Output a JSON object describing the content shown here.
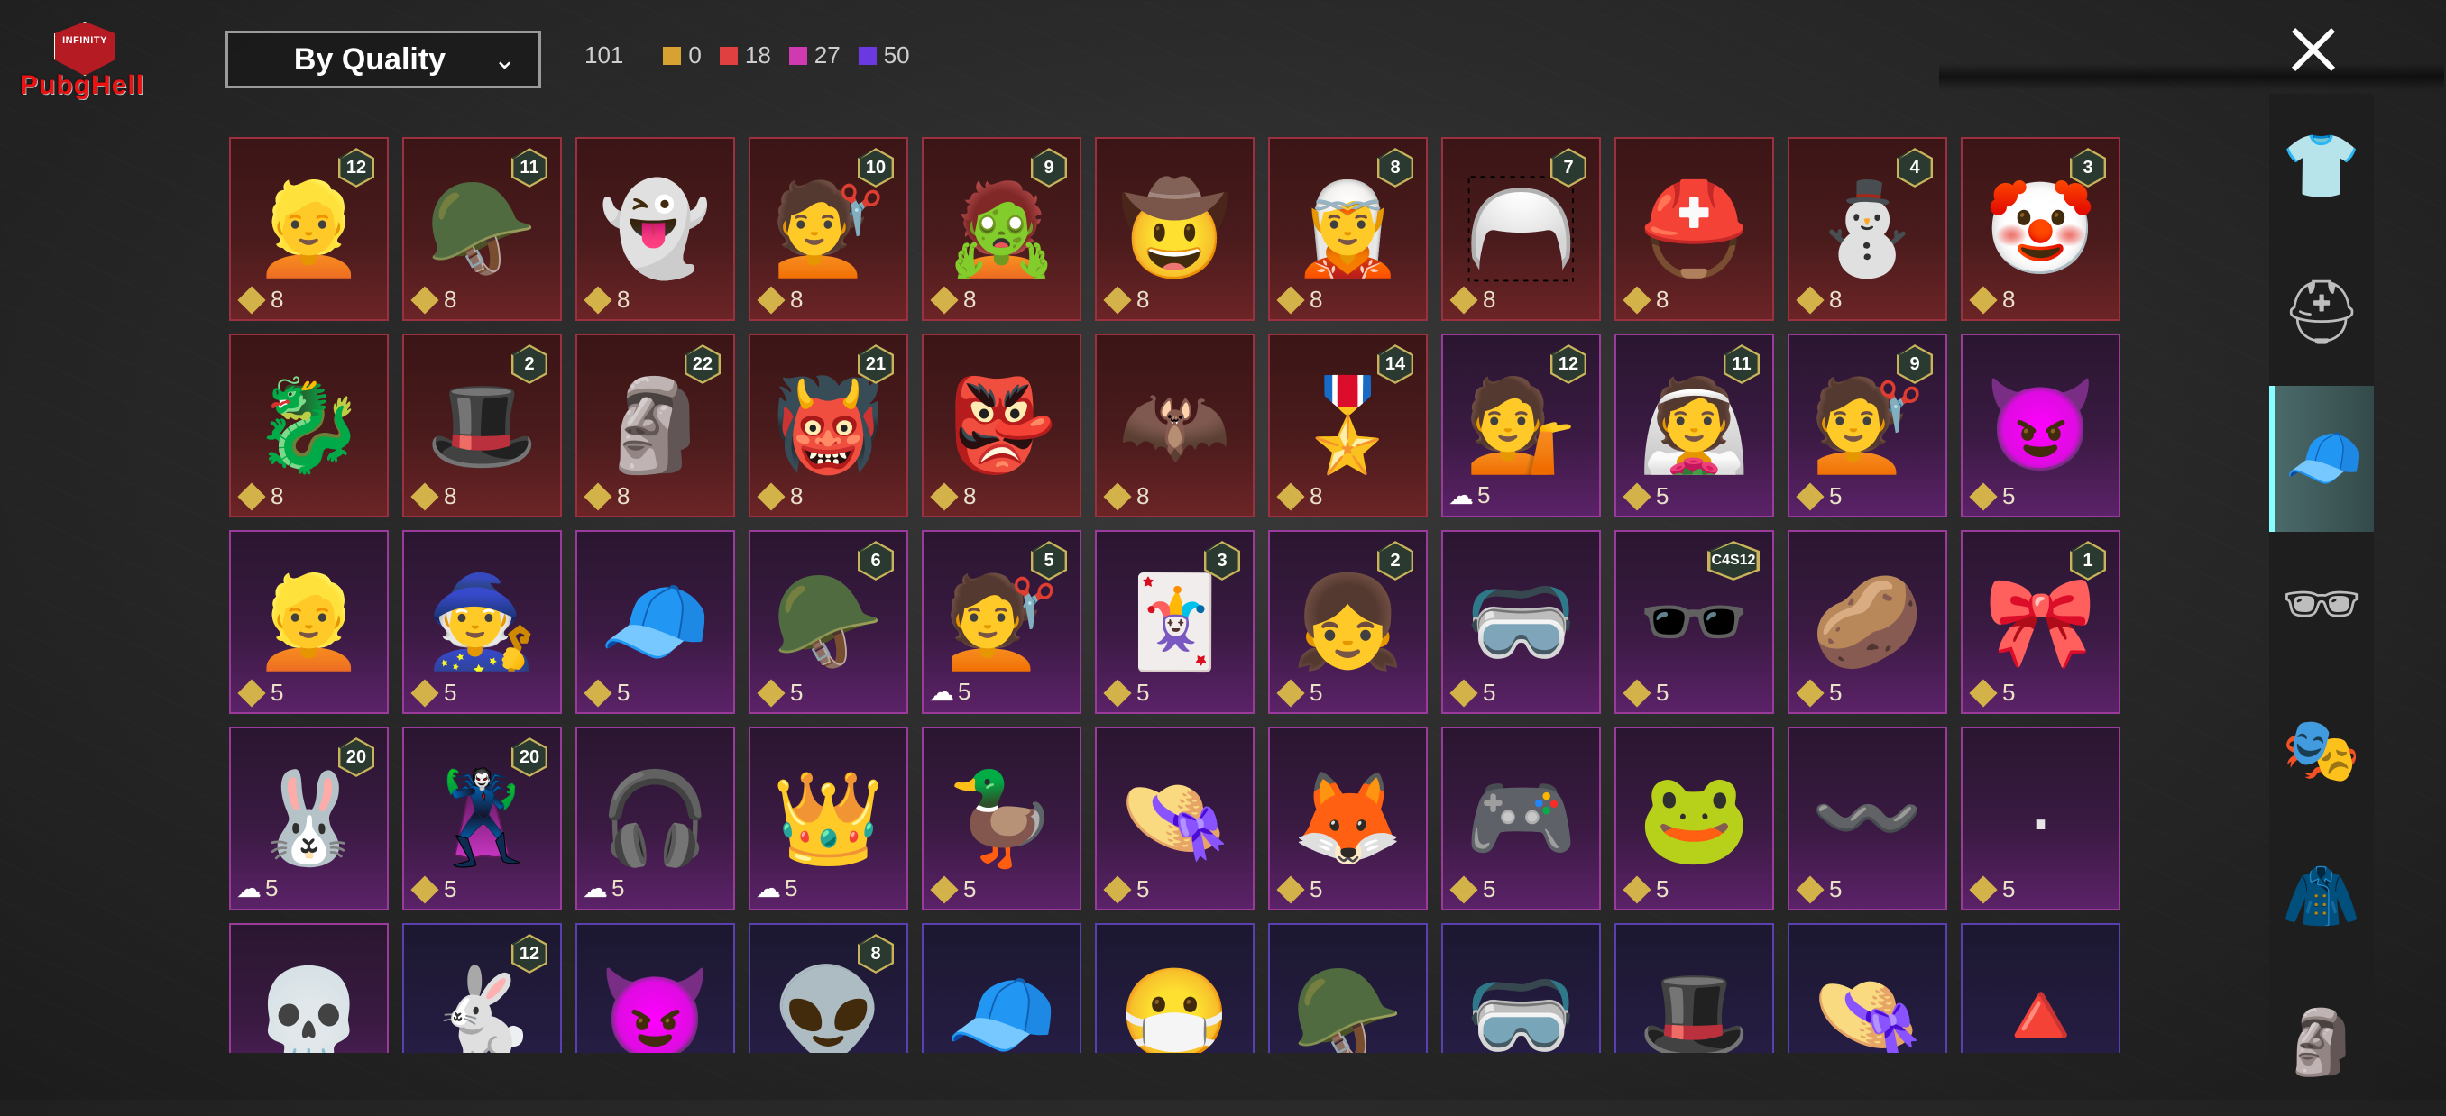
{
  "logo": {
    "top_text": "INFINITY",
    "word": "PubgHell"
  },
  "sort": {
    "label": "By Quality"
  },
  "stats": {
    "total": "101",
    "groups": [
      {
        "color": "#d8a232",
        "count": "0"
      },
      {
        "color": "#e04040",
        "count": "18"
      },
      {
        "color": "#d03ab0",
        "count": "27"
      },
      {
        "color": "#6a3ae0",
        "count": "50"
      }
    ]
  },
  "grid": {
    "rows": [
      [
        {
          "quality": "red",
          "icon": "👱",
          "badge": "12",
          "count": "8",
          "cloud": false
        },
        {
          "quality": "red",
          "icon": "🪖",
          "badge": "11",
          "count": "8",
          "cloud": false
        },
        {
          "quality": "red",
          "icon": "👻",
          "badge": "",
          "count": "8",
          "cloud": false
        },
        {
          "quality": "red",
          "icon": "💇",
          "badge": "10",
          "count": "8",
          "cloud": false
        },
        {
          "quality": "red",
          "icon": "🧟",
          "badge": "9",
          "count": "8",
          "cloud": false
        },
        {
          "quality": "red",
          "icon": "🤠",
          "badge": "",
          "count": "8",
          "cloud": false
        },
        {
          "quality": "red",
          "icon": "🧝",
          "badge": "8",
          "count": "8",
          "cloud": false
        },
        {
          "quality": "red",
          "icon": "🦳",
          "badge": "7",
          "count": "8",
          "cloud": false
        },
        {
          "quality": "red",
          "icon": "⛑️",
          "badge": "",
          "count": "8",
          "cloud": false
        },
        {
          "quality": "red",
          "icon": "⛄",
          "badge": "4",
          "count": "8",
          "cloud": false
        },
        {
          "quality": "red",
          "icon": "🤡",
          "badge": "3",
          "count": "8",
          "cloud": false
        }
      ],
      [
        {
          "quality": "red",
          "icon": "🐉",
          "badge": "",
          "count": "8",
          "cloud": false
        },
        {
          "quality": "red",
          "icon": "🎩",
          "badge": "2",
          "count": "8",
          "cloud": false
        },
        {
          "quality": "red",
          "icon": "🗿",
          "badge": "22",
          "count": "8",
          "cloud": false
        },
        {
          "quality": "red",
          "icon": "👹",
          "badge": "21",
          "count": "8",
          "cloud": false
        },
        {
          "quality": "red",
          "icon": "👺",
          "badge": "",
          "count": "8",
          "cloud": false
        },
        {
          "quality": "red",
          "icon": "🦇",
          "badge": "",
          "count": "8",
          "cloud": false
        },
        {
          "quality": "red",
          "icon": "🎖️",
          "badge": "14",
          "count": "8",
          "cloud": false
        },
        {
          "quality": "purple",
          "icon": "💁",
          "badge": "12",
          "count": "5",
          "cloud": true
        },
        {
          "quality": "purple",
          "icon": "👰",
          "badge": "11",
          "count": "5",
          "cloud": false
        },
        {
          "quality": "purple",
          "icon": "💇",
          "badge": "9",
          "count": "5",
          "cloud": false
        },
        {
          "quality": "purple",
          "icon": "😈",
          "badge": "",
          "count": "5",
          "cloud": false
        }
      ],
      [
        {
          "quality": "purple",
          "icon": "👱",
          "badge": "",
          "count": "5",
          "cloud": false
        },
        {
          "quality": "purple",
          "icon": "🧙",
          "badge": "",
          "count": "5",
          "cloud": false
        },
        {
          "quality": "purple",
          "icon": "🧢",
          "badge": "",
          "count": "5",
          "cloud": false
        },
        {
          "quality": "purple",
          "icon": "🪖",
          "badge": "6",
          "count": "5",
          "cloud": false
        },
        {
          "quality": "purple",
          "icon": "💇",
          "badge": "5",
          "count": "5",
          "cloud": true
        },
        {
          "quality": "purple",
          "icon": "🃏",
          "badge": "3",
          "count": "5",
          "cloud": false
        },
        {
          "quality": "purple",
          "icon": "👧",
          "badge": "2",
          "count": "5",
          "cloud": false
        },
        {
          "quality": "purple",
          "icon": "🥽",
          "badge": "",
          "count": "5",
          "cloud": false
        },
        {
          "quality": "purple",
          "icon": "🕶️",
          "badge": "C4S12",
          "count": "5",
          "cloud": false
        },
        {
          "quality": "purple",
          "icon": "🥔",
          "badge": "",
          "count": "5",
          "cloud": false
        },
        {
          "quality": "purple",
          "icon": "🎀",
          "badge": "1",
          "count": "5",
          "cloud": false
        }
      ],
      [
        {
          "quality": "purple",
          "icon": "🐰",
          "badge": "20",
          "count": "5",
          "cloud": true
        },
        {
          "quality": "purple",
          "icon": "🦹",
          "badge": "20",
          "count": "5",
          "cloud": false
        },
        {
          "quality": "purple",
          "icon": "🎧",
          "badge": "",
          "count": "5",
          "cloud": true
        },
        {
          "quality": "purple",
          "icon": "👑",
          "badge": "",
          "count": "5",
          "cloud": true
        },
        {
          "quality": "purple",
          "icon": "🦆",
          "badge": "",
          "count": "5",
          "cloud": false
        },
        {
          "quality": "purple",
          "icon": "👒",
          "badge": "",
          "count": "5",
          "cloud": false
        },
        {
          "quality": "purple",
          "icon": "🦊",
          "badge": "",
          "count": "5",
          "cloud": false
        },
        {
          "quality": "purple",
          "icon": "🎮",
          "badge": "",
          "count": "5",
          "cloud": false
        },
        {
          "quality": "purple",
          "icon": "🐸",
          "badge": "",
          "count": "5",
          "cloud": false
        },
        {
          "quality": "purple",
          "icon": "〰️",
          "badge": "",
          "count": "5",
          "cloud": false
        },
        {
          "quality": "purple",
          "icon": "·",
          "badge": "",
          "count": "5",
          "cloud": false
        }
      ],
      [
        {
          "quality": "purple",
          "icon": "💀",
          "badge": "",
          "count": "",
          "cloud": false
        },
        {
          "quality": "violet",
          "icon": "🐇",
          "badge": "12",
          "count": "",
          "cloud": false
        },
        {
          "quality": "violet",
          "icon": "😈",
          "badge": "",
          "count": "",
          "cloud": false
        },
        {
          "quality": "violet",
          "icon": "👽",
          "badge": "8",
          "count": "",
          "cloud": false
        },
        {
          "quality": "violet",
          "icon": "🧢",
          "badge": "",
          "count": "",
          "cloud": false
        },
        {
          "quality": "violet",
          "icon": "😷",
          "badge": "",
          "count": "",
          "cloud": false
        },
        {
          "quality": "violet",
          "icon": "🪖",
          "badge": "",
          "count": "",
          "cloud": false
        },
        {
          "quality": "violet",
          "icon": "🥽",
          "badge": "",
          "count": "",
          "cloud": false
        },
        {
          "quality": "violet",
          "icon": "🎩",
          "badge": "",
          "count": "",
          "cloud": false
        },
        {
          "quality": "violet",
          "icon": "👒",
          "badge": "",
          "count": "",
          "cloud": false
        },
        {
          "quality": "violet",
          "icon": "🔺",
          "badge": "",
          "count": "",
          "cloud": false
        }
      ]
    ]
  },
  "sidebar": {
    "categories": [
      {
        "name": "outfit-icon",
        "glyph": "👕",
        "active": false
      },
      {
        "name": "helmet-icon",
        "glyph": "⛑",
        "active": false
      },
      {
        "name": "hat-icon",
        "glyph": "🧢",
        "active": true
      },
      {
        "name": "glasses-icon",
        "glyph": "🕶",
        "active": false
      },
      {
        "name": "mask-icon",
        "glyph": "🎭",
        "active": false
      },
      {
        "name": "jacket-icon",
        "glyph": "🧥",
        "active": false
      },
      {
        "name": "face-icon",
        "glyph": "🗿",
        "active": false
      }
    ]
  }
}
